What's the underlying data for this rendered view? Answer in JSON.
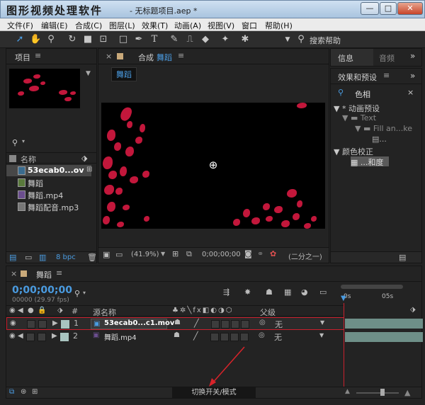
{
  "window": {
    "app_title": "图形视频处理软件",
    "doc_title": "- 无标题项目.aep *",
    "buttons": {
      "minimize": "—",
      "maximize": "□",
      "close": "✕"
    }
  },
  "menu": [
    "文件(F)",
    "编辑(E)",
    "合成(C)",
    "图层(L)",
    "效果(T)",
    "动画(A)",
    "视图(V)",
    "窗口",
    "帮助(H)"
  ],
  "toolbar": {
    "search_help": "搜索帮助"
  },
  "project": {
    "tab": "项目",
    "search_placeholder": "",
    "column_name": "名称",
    "bpc": "8 bpc",
    "items": [
      {
        "name": "53ecab0...ov",
        "type": "video",
        "selected": true
      },
      {
        "name": "舞蹈",
        "type": "comp"
      },
      {
        "name": "舞蹈.mp4",
        "type": "video"
      },
      {
        "name": "舞蹈配音.mp3",
        "type": "audio"
      }
    ]
  },
  "composition": {
    "tab_prefix": "合成",
    "tab_name": "舞蹈",
    "chip": "舞蹈",
    "zoom": "(41.9%)",
    "timecode": "0;00;00;00",
    "resolution": "(二分之一)"
  },
  "info_panel": {
    "tab_info": "信息",
    "tab_audio": "音频"
  },
  "effects": {
    "tab": "效果和预设",
    "search_value": "色相",
    "tree": [
      {
        "label": "* 动画预设",
        "level": 0
      },
      {
        "label": "Text",
        "level": 1
      },
      {
        "label": "Fill an...ke",
        "level": 2
      },
      {
        "label": "...",
        "level": 3
      },
      {
        "label": "颜色校正",
        "level": 0
      },
      {
        "label": "...和度",
        "level": 1,
        "selected": true
      }
    ]
  },
  "timeline": {
    "tab": "舞蹈",
    "timecode": "0;00;00;00",
    "fps": "00000 (29.97 fps)",
    "ruler": [
      "0s",
      "05s"
    ],
    "columns": {
      "num": "#",
      "source": "源名称",
      "parent": "父级"
    },
    "layers": [
      {
        "num": "1",
        "name": "53ecab0...c1.mov",
        "parent": "无",
        "selected": true
      },
      {
        "num": "2",
        "name": "舞蹈.mp4",
        "parent": "无"
      }
    ],
    "toggle_label": "切换开关/模式"
  },
  "colors": {
    "accent_blue": "#4a9be0",
    "selection_red": "#c9202e",
    "petal": "#c2173b",
    "layer_bar": "#6e8f88"
  }
}
